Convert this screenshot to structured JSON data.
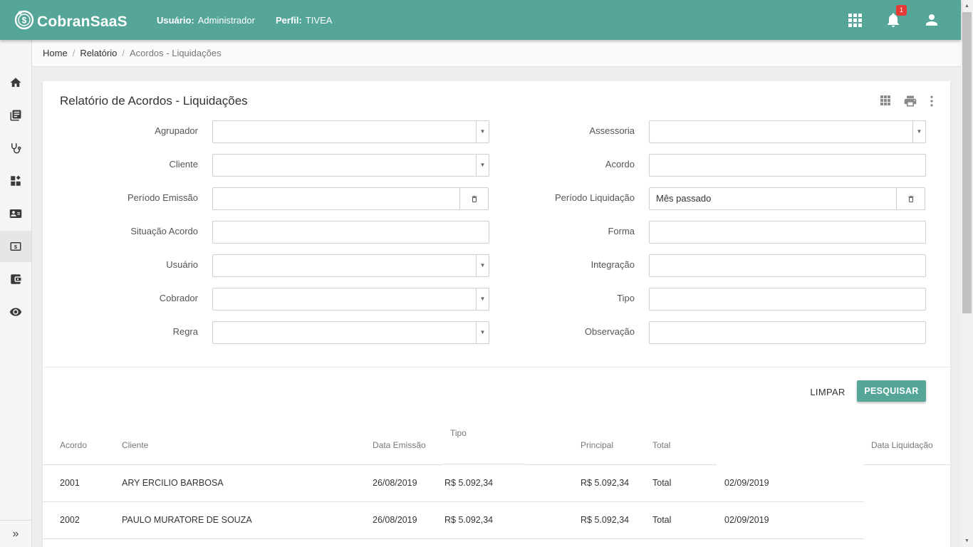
{
  "header": {
    "logo_text": "CobranSaaS",
    "user_label": "Usuário:",
    "user_value": "Administrador",
    "profile_label": "Perfil:",
    "profile_value": "TIVEA",
    "notification_count": "1",
    "color": "#55a698"
  },
  "breadcrumb": [
    "Home",
    "Relatório",
    "Acordos - Liquidações"
  ],
  "sidebar": {
    "items": [
      "home-icon",
      "book-icon",
      "stethoscope-icon",
      "dashboard-icon",
      "contact-card-icon",
      "money-icon",
      "wallet-icon",
      "eye-icon"
    ],
    "active": "money-icon",
    "expand_label": "»"
  },
  "card": {
    "title": "Relatório de Acordos - Liquidações"
  },
  "filters": {
    "agrupador": {
      "label": "Agrupador",
      "value": ""
    },
    "cliente": {
      "label": "Cliente",
      "value": ""
    },
    "periodo_emissao": {
      "label": "Período Emissão",
      "value": ""
    },
    "situacao_acordo": {
      "label": "Situação Acordo",
      "value": ""
    },
    "usuario": {
      "label": "Usuário",
      "value": ""
    },
    "cobrador": {
      "label": "Cobrador",
      "value": ""
    },
    "regra": {
      "label": "Regra",
      "value": ""
    },
    "assessoria": {
      "label": "Assessoria",
      "value": ""
    },
    "acordo": {
      "label": "Acordo",
      "value": ""
    },
    "periodo_liquidacao": {
      "label": "Período Liquidação",
      "value": "Mês passado"
    },
    "forma": {
      "label": "Forma",
      "value": ""
    },
    "integracao": {
      "label": "Integração",
      "value": ""
    },
    "tipo": {
      "label": "Tipo",
      "value": ""
    },
    "observacao": {
      "label": "Observação",
      "value": ""
    }
  },
  "buttons": {
    "clear": "LIMPAR",
    "search": "PESQUISAR"
  },
  "table": {
    "headers": {
      "acordo": "Acordo",
      "cliente": "Cliente",
      "data_emissao": "Data Emissão",
      "tipo": "Tipo",
      "principal": "Principal",
      "total": "Total",
      "data_liquidacao": "Data Liquidação"
    },
    "rows": [
      {
        "acordo": "2001",
        "cliente": "ARY ERCILIO BARBOSA",
        "data_emissao": "26/08/2019",
        "tipo": "R$ 5.092,34",
        "principal": "R$ 5.092,34",
        "total": "Total",
        "data_liquidacao": "02/09/2019"
      },
      {
        "acordo": "2002",
        "cliente": "PAULO MURATORE DE SOUZA",
        "data_emissao": "26/08/2019",
        "tipo": "R$ 5.092,34",
        "principal": "R$ 5.092,34",
        "total": "Total",
        "data_liquidacao": "02/09/2019"
      }
    ]
  }
}
